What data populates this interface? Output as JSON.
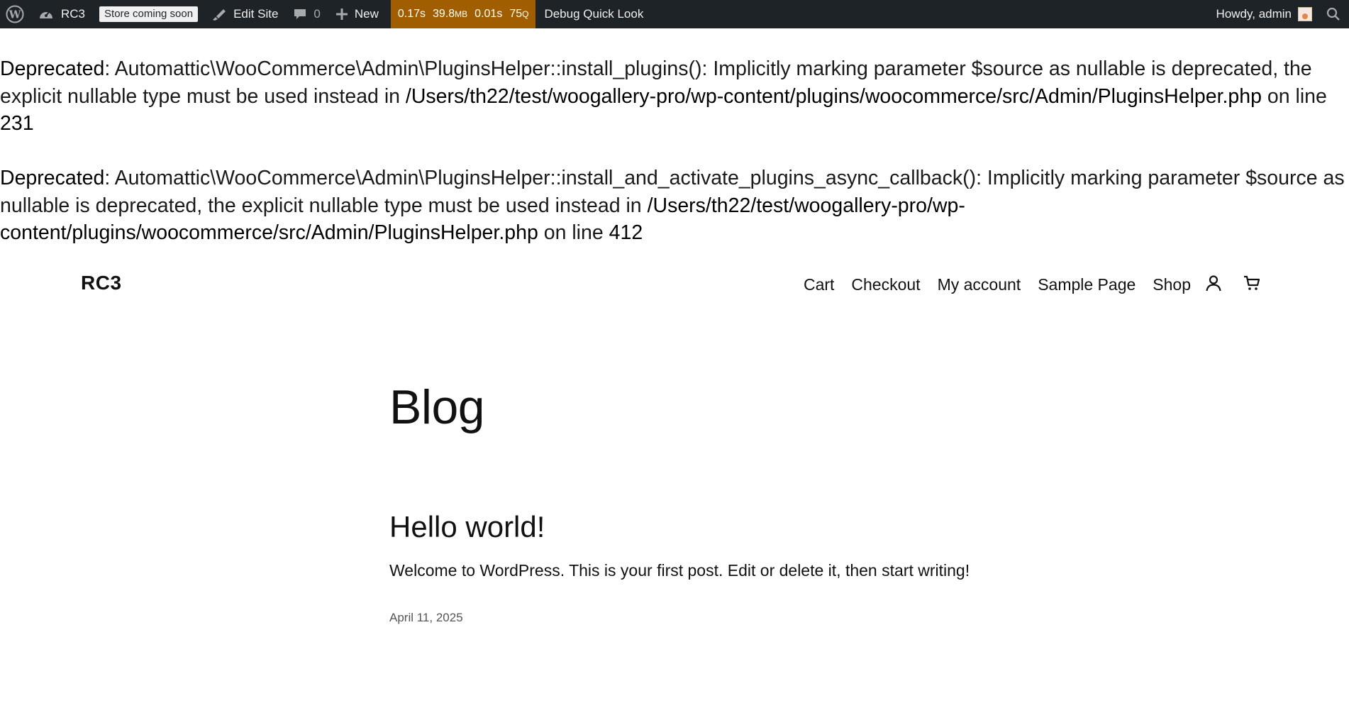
{
  "admin_bar": {
    "site_name": "RC3",
    "store_badge": "Store coming soon",
    "edit_site": "Edit Site",
    "comments_count": "0",
    "new_label": "New",
    "perf": {
      "time": "0.17s",
      "memory_value": "39.8",
      "memory_unit": "MB",
      "query_time": "0.01s",
      "query_count": "75",
      "query_unit": "Q"
    },
    "debug_label": "Debug Quick Look",
    "howdy": "Howdy, admin"
  },
  "notices": [
    {
      "label": "Deprecated",
      "message": ": Automattic\\WooCommerce\\Admin\\PluginsHelper::install_plugins(): Implicitly marking parameter $source as nullable is deprecated, the explicit nullable type must be used instead in ",
      "file": "/Users/th22/test/woogallery-pro/wp-content/plugins/woocommerce/src/Admin/PluginsHelper.php",
      "line_text": " on line ",
      "line": "231"
    },
    {
      "label": "Deprecated",
      "message": ": Automattic\\WooCommerce\\Admin\\PluginsHelper::install_and_activate_plugins_async_callback(): Implicitly marking parameter $source as nullable is deprecated, the explicit nullable type must be used instead in ",
      "file": "/Users/th22/test/woogallery-pro/wp-content/plugins/woocommerce/src/Admin/PluginsHelper.php",
      "line_text": " on line ",
      "line": "412"
    }
  ],
  "site": {
    "title": "RC3",
    "nav": {
      "cart": "Cart",
      "checkout": "Checkout",
      "my_account": "My account",
      "sample_page": "Sample Page",
      "shop": "Shop"
    }
  },
  "main": {
    "page_title": "Blog",
    "post": {
      "title": "Hello world!",
      "excerpt": "Welcome to WordPress. This is your first post. Edit or delete it, then start writing!",
      "date": "April 11, 2025"
    }
  },
  "icons": {
    "wp_logo": "wordpress-logo-icon",
    "dashboard": "dashboard-gauge-icon",
    "edit_site": "brush-icon",
    "comments": "comment-bubble-icon",
    "new": "plus-icon",
    "search": "search-icon",
    "account": "user-icon",
    "cart": "cart-icon"
  }
}
